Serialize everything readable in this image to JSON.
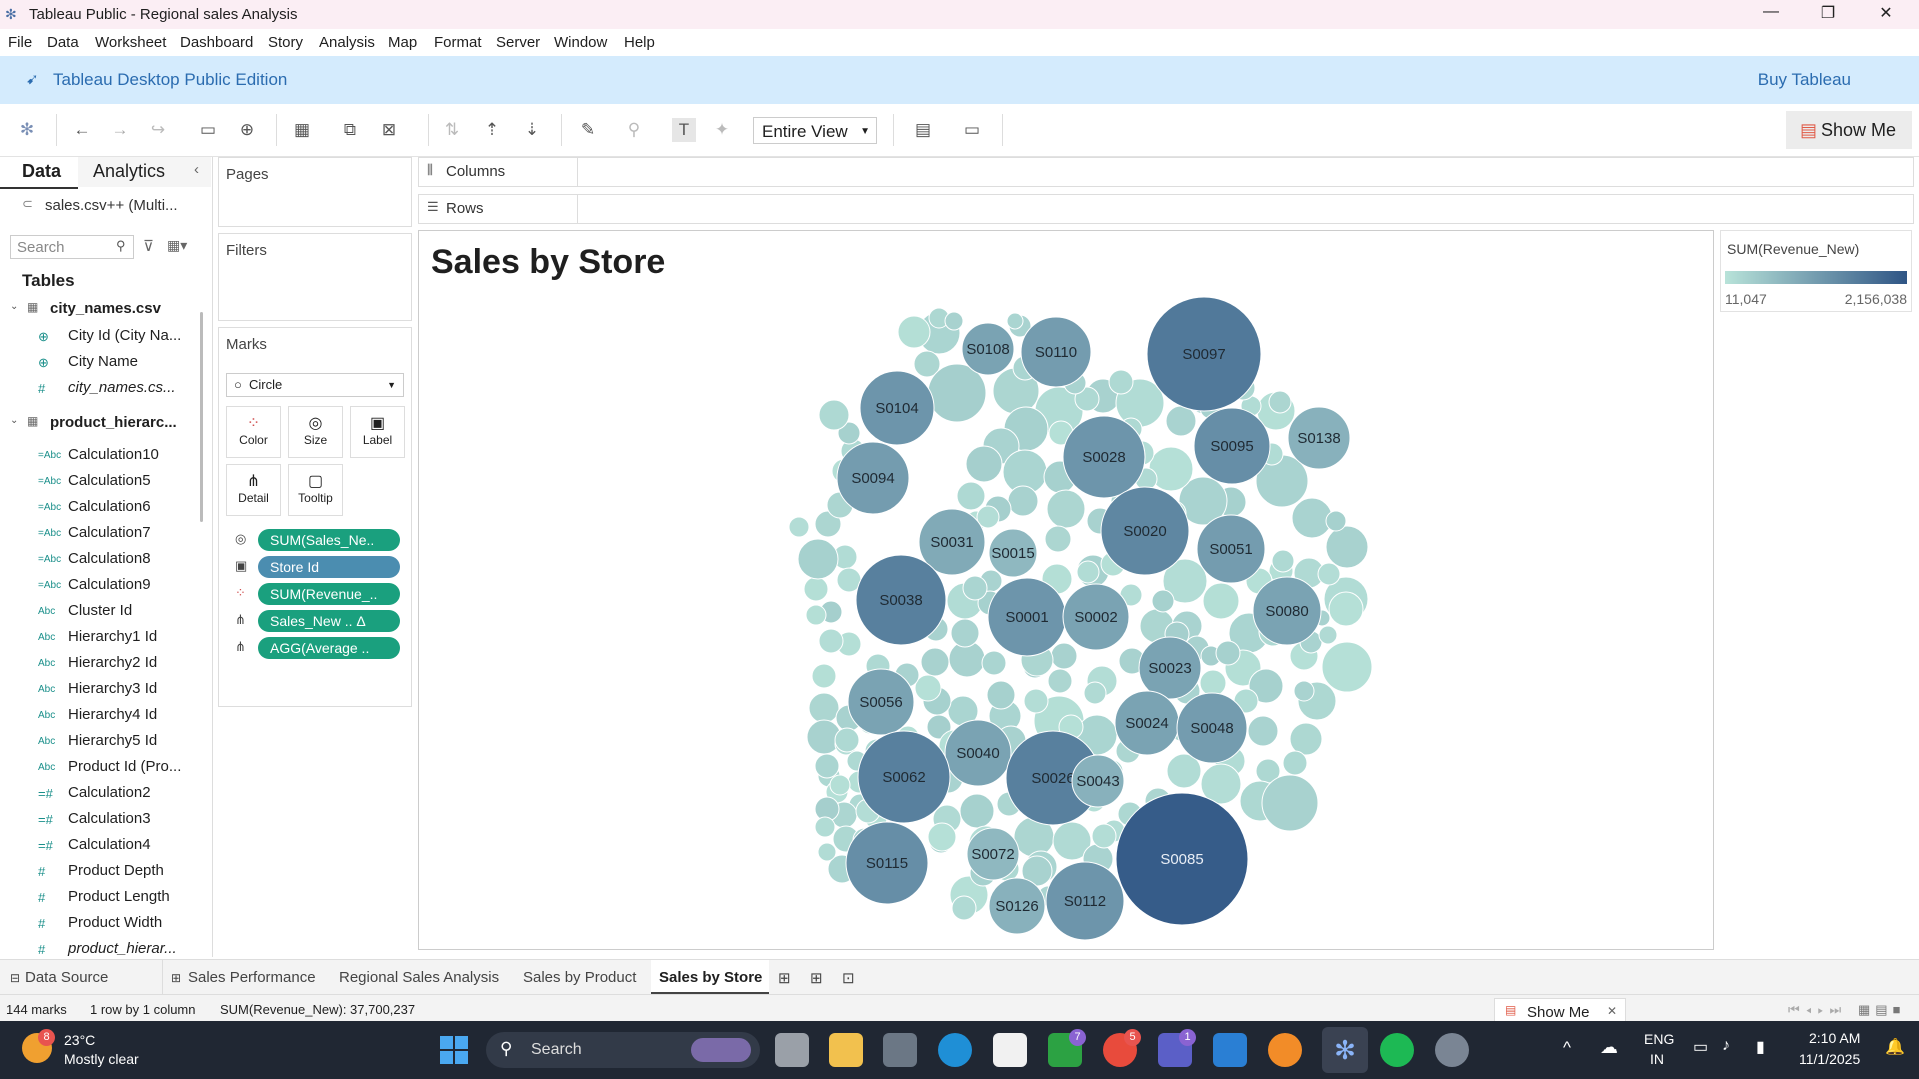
{
  "window": {
    "title": "Tableau Public - Regional sales Analysis"
  },
  "menu": [
    "File",
    "Data",
    "Worksheet",
    "Dashboard",
    "Story",
    "Analysis",
    "Map",
    "Format",
    "Server",
    "Window",
    "Help"
  ],
  "banner": {
    "edition": "Tableau Desktop Public Edition",
    "buy": "Buy Tableau"
  },
  "toolbar": {
    "fit": "Entire View",
    "show_me": "Show Me"
  },
  "data_pane": {
    "tabs": [
      "Data",
      "Analytics"
    ],
    "source": "sales.csv++ (Multi...",
    "search_placeholder": "Search",
    "tables_heading": "Tables",
    "table1": {
      "name": "city_names.csv",
      "fields": [
        "City Id (City Na...",
        "City Name",
        "city_names.cs..."
      ]
    },
    "table2": {
      "name": "product_hierarc...",
      "fields": [
        "Calculation10",
        "Calculation5",
        "Calculation6",
        "Calculation7",
        "Calculation8",
        "Calculation9",
        "Cluster Id",
        "Hierarchy1 Id",
        "Hierarchy2 Id",
        "Hierarchy3 Id",
        "Hierarchy4 Id",
        "Hierarchy5 Id",
        "Product Id (Pro...",
        "Calculation2",
        "Calculation3",
        "Calculation4",
        "Product Depth",
        "Product Length",
        "Product Width",
        "product_hierar..."
      ]
    }
  },
  "shelves": {
    "pages": "Pages",
    "filters": "Filters",
    "marks": "Marks",
    "mark_type": "Circle",
    "buttons": [
      "Color",
      "Size",
      "Label",
      "Detail",
      "Tooltip"
    ],
    "pills": [
      {
        "text": "SUM(Sales_Ne..",
        "color": "#1aa07e"
      },
      {
        "text": "Store Id",
        "color": "#4b8db0"
      },
      {
        "text": "SUM(Revenue_..",
        "color": "#1aa07e"
      },
      {
        "text": "Sales_New .. Δ",
        "color": "#1aa07e"
      },
      {
        "text": "AGG(Average ..",
        "color": "#1aa07e"
      }
    ],
    "columns": "Columns",
    "rows": "Rows"
  },
  "legend": {
    "title": "SUM(Revenue_New)",
    "min": "11,047",
    "max": "2,156,038",
    "color_low": "#b8e3d9",
    "color_high": "#2f5585"
  },
  "sheet_tabs": [
    "Data Source",
    "Sales Performance",
    "Regional Sales Analysis",
    "Sales by Product",
    "Sales by Store"
  ],
  "active_tab": "Sales by Store",
  "status": {
    "marks": "144 marks",
    "dims": "1 row by 1 column",
    "sum": "SUM(Revenue_New): 37,700,237",
    "show_me": "Show Me"
  },
  "taskbar": {
    "temp": "23°C",
    "weather": "Mostly clear",
    "search": "Search",
    "lang1": "ENG",
    "lang2": "IN",
    "time": "2:10 AM",
    "date": "11/1/2025",
    "weather_badge": "8",
    "xbox_badge": "7",
    "chrome_badge": "5",
    "teams_badge": "1"
  },
  "chart_data": {
    "type": "packed_bubble",
    "title": "Sales by Store",
    "labeled_stores": [
      "S0097",
      "S0108",
      "S0110",
      "S0104",
      "S0138",
      "S0095",
      "S0028",
      "S0094",
      "S0020",
      "S0031",
      "S0015",
      "S0051",
      "S0038",
      "S0001",
      "S0002",
      "S0080",
      "S0023",
      "S0056",
      "S0024",
      "S0048",
      "S0040",
      "S0026",
      "S0043",
      "S0062",
      "S0085",
      "S0115",
      "S0072",
      "S0112",
      "S0126"
    ]
  }
}
